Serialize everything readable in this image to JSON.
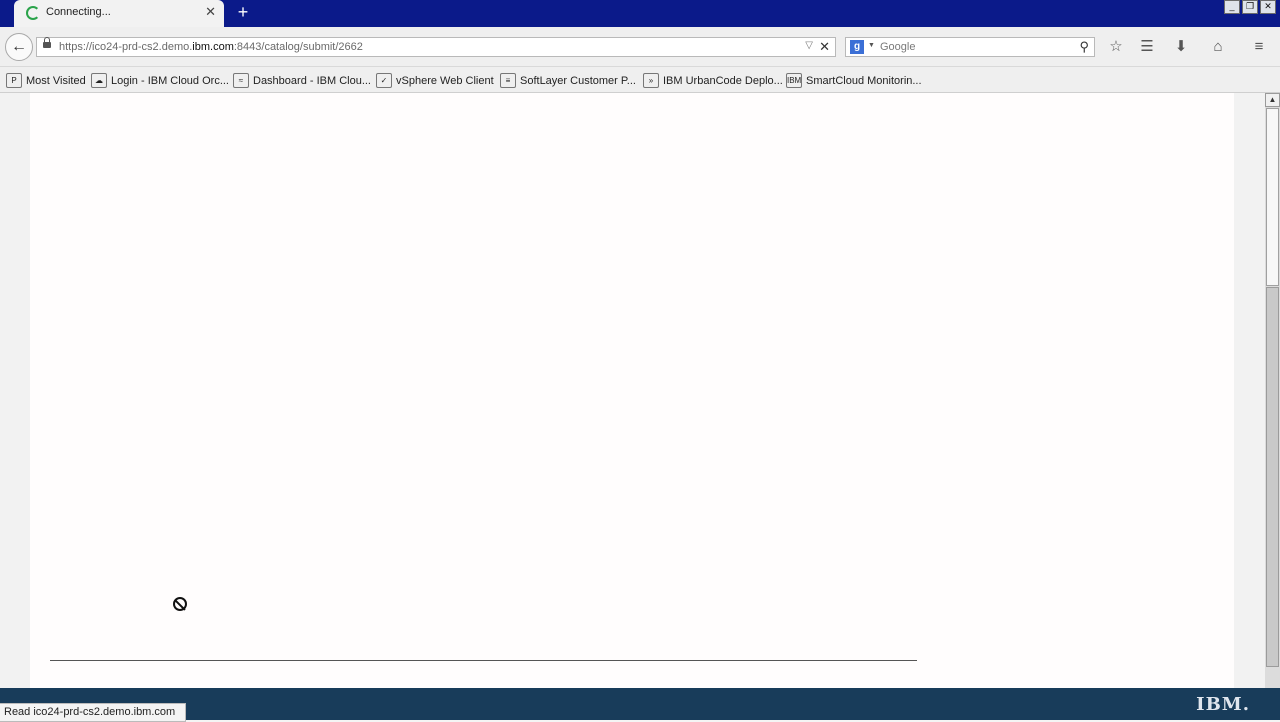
{
  "tab": {
    "title": "Connecting...",
    "close_label": "✕"
  },
  "newtab_label": "+",
  "window_controls": {
    "minimize": "_",
    "restore": "❐",
    "close": "✕"
  },
  "navigation": {
    "back_label": "←",
    "url_prefix": "https://ico24-prd-cs2.demo.",
    "url_domain": "ibm.com",
    "url_suffix": ":8443/catalog/submit/2662",
    "url_dropdown": "▽",
    "url_stop": "✕"
  },
  "search": {
    "engine_icon": "g",
    "engine_dropdown": "▼",
    "placeholder": "Google",
    "submit_icon": "⚲"
  },
  "toolbar_icons": {
    "bookmark_star": "☆",
    "bookmarks_menu": "☰",
    "downloads": "⬇",
    "home": "⌂",
    "menu": "≡"
  },
  "bookmarks": [
    {
      "label": "Most Visited",
      "icon": "P"
    },
    {
      "label": "Login - IBM Cloud Orc...",
      "icon": "☁"
    },
    {
      "label": "Dashboard - IBM Clou...",
      "icon": "≈"
    },
    {
      "label": "vSphere Web Client",
      "icon": "✓"
    },
    {
      "label": "SoftLayer Customer P...",
      "icon": "≡"
    },
    {
      "label": "IBM UrbanCode Deplo...",
      "icon": "»"
    },
    {
      "label": "SmartCloud Monitorin...",
      "icon": "IBM"
    }
  ],
  "scrollbar": {
    "up_arrow": "▲",
    "down_arrow": "▼",
    "position": 0.66
  },
  "footer": {
    "logo": "IBM."
  },
  "status_text": "Read ico24-prd-cs2.demo.ibm.com",
  "colors": {
    "titlebar": "#0b1a8a",
    "footer": "#183c5a",
    "page": "#fffdfd"
  }
}
